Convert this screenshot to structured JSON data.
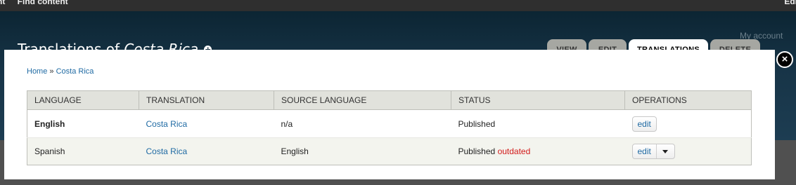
{
  "toolbar": {
    "left_items": [
      "nt",
      "Find content"
    ],
    "right": "Edit"
  },
  "header": {
    "title_prefix": "Translations of ",
    "title_subject": "Costa Rica",
    "my_account": "My account",
    "tabs": [
      {
        "label": "View"
      },
      {
        "label": "Edit"
      },
      {
        "label": "Translations",
        "active": true
      },
      {
        "label": "Delete"
      }
    ]
  },
  "breadcrumb": {
    "home": "Home",
    "sep": " » ",
    "current": "Costa Rica"
  },
  "table": {
    "columns": [
      "Language",
      "Translation",
      "Source language",
      "Status",
      "Operations"
    ],
    "rows": [
      {
        "language": "English",
        "translation": "Costa Rica",
        "source": "n/a",
        "status": "Published",
        "status_flag": "",
        "op": "edit"
      },
      {
        "language": "Spanish",
        "translation": "Costa Rica",
        "source": "English",
        "status": "Published",
        "status_flag": "outdated",
        "op": "edit"
      }
    ]
  },
  "colors": {
    "accent_link": "#1f6aa3",
    "outdated": "#d21a1a",
    "header_bg": "#173447"
  }
}
